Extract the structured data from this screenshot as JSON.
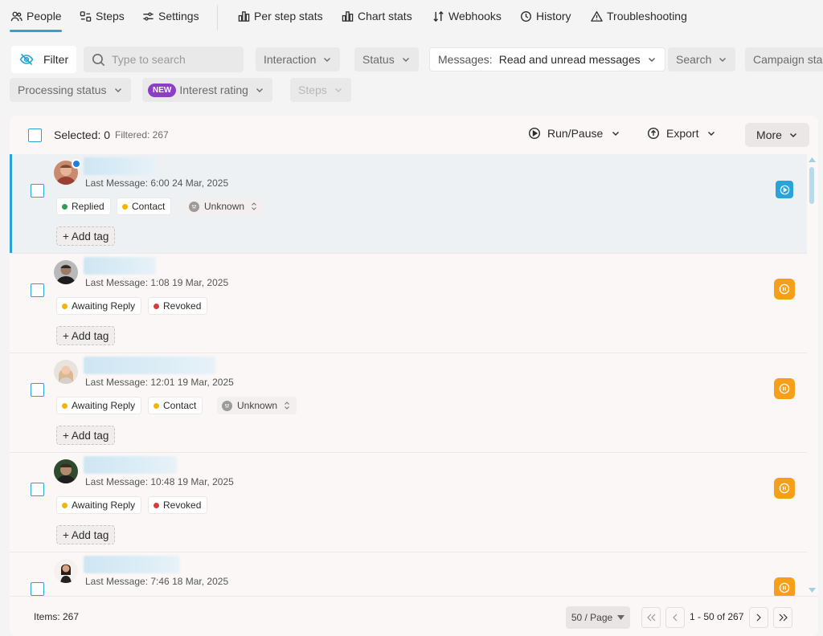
{
  "nav": {
    "tabs": [
      {
        "label": "People",
        "icon": "users-icon"
      },
      {
        "label": "Steps",
        "icon": "steps-icon"
      },
      {
        "label": "Settings",
        "icon": "sliders-icon"
      },
      {
        "label": "Per step stats",
        "icon": "bar-chart-icon"
      },
      {
        "label": "Chart stats",
        "icon": "bar-chart-icon"
      },
      {
        "label": "Webhooks",
        "icon": "sort-arrows-icon"
      },
      {
        "label": "History",
        "icon": "clock-icon"
      },
      {
        "label": "Troubleshooting",
        "icon": "warning-icon"
      }
    ],
    "active_tab": "People"
  },
  "filters": {
    "filter_label": "Filter",
    "search_placeholder": "Type to search",
    "interaction": "Interaction",
    "status": "Status",
    "messages_label": "Messages:",
    "messages_value": "Read and unread messages",
    "search_dropdown": "Search",
    "campaign": "Campaign sta",
    "processing_status": "Processing status",
    "new_badge": "NEW",
    "interest_rating": "Interest rating",
    "steps": "Steps"
  },
  "list_header": {
    "selected": "Selected: 0",
    "filtered": "Filtered: 267",
    "run_pause": "Run/Pause",
    "export": "Export",
    "more": "More"
  },
  "people": [
    {
      "last_message": "Last Message: 6:00 24 Mar, 2025",
      "tags": [
        "Replied",
        "Contact"
      ],
      "rating": "Unknown",
      "add_tag": "+ Add tag",
      "action": "run"
    },
    {
      "last_message": "Last Message: 1:08 19 Mar, 2025",
      "tags": [
        "Awaiting Reply",
        "Revoked"
      ],
      "rating": "",
      "add_tag": "+ Add tag",
      "action": "pause"
    },
    {
      "last_message": "Last Message: 12:01 19 Mar, 2025",
      "tags": [
        "Awaiting Reply",
        "Contact"
      ],
      "rating": "Unknown",
      "add_tag": "+ Add tag",
      "action": "pause"
    },
    {
      "last_message": "Last Message: 10:48 19 Mar, 2025",
      "tags": [
        "Awaiting Reply",
        "Revoked"
      ],
      "rating": "",
      "add_tag": "+ Add tag",
      "action": "pause"
    },
    {
      "last_message": "Last Message: 7:46 18 Mar, 2025",
      "tags": [],
      "rating": "",
      "add_tag": "",
      "action": "pause"
    }
  ],
  "tag_colors": {
    "Replied": "#2e9e4f",
    "Contact": "#f5b400",
    "Awaiting Reply": "#f5b400",
    "Revoked": "#d93a3a"
  },
  "footer": {
    "items": "Items: 267",
    "page_size": "50 / Page",
    "range": "1 - 50 of 267"
  },
  "colors": {
    "accent": "#2aa3d6",
    "pause": "#f6a01a",
    "new_badge": "#8b3fc7"
  }
}
